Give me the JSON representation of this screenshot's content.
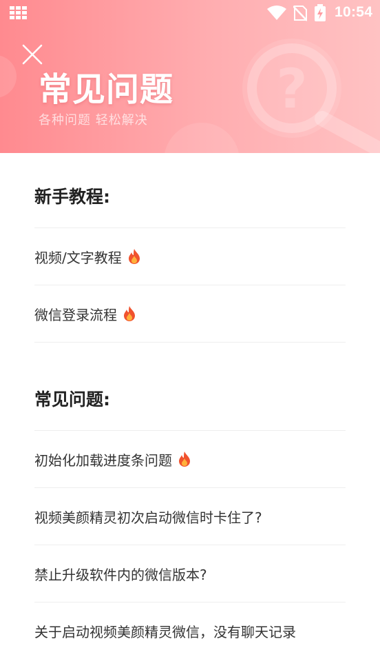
{
  "status_bar": {
    "time": "10:54",
    "icons": [
      "apps-grid-icon",
      "wifi-icon",
      "no-sim-icon",
      "battery-charging-icon"
    ]
  },
  "header": {
    "title": "常见问题",
    "subtitle": "各种问题 轻松解决",
    "close_icon": "close-icon",
    "decor_icon": "magnifier-question-icon"
  },
  "sections": [
    {
      "title": "新手教程:",
      "items": [
        {
          "label": "视频/文字教程",
          "hot": true
        },
        {
          "label": "微信登录流程",
          "hot": true
        }
      ]
    },
    {
      "title": "常见问题:",
      "items": [
        {
          "label": "初始化加载进度条问题",
          "hot": true
        },
        {
          "label": "视频美颜精灵初次启动微信时卡住了?",
          "hot": false
        },
        {
          "label": "禁止升级软件内的微信版本?",
          "hot": false
        },
        {
          "label": "关于启动视频美颜精灵微信，没有聊天记录",
          "hot": false
        }
      ]
    }
  ],
  "colors": {
    "header_start": "#ff8a8f",
    "header_end": "#ffc2c3",
    "hot_icon": "#f0522e"
  }
}
